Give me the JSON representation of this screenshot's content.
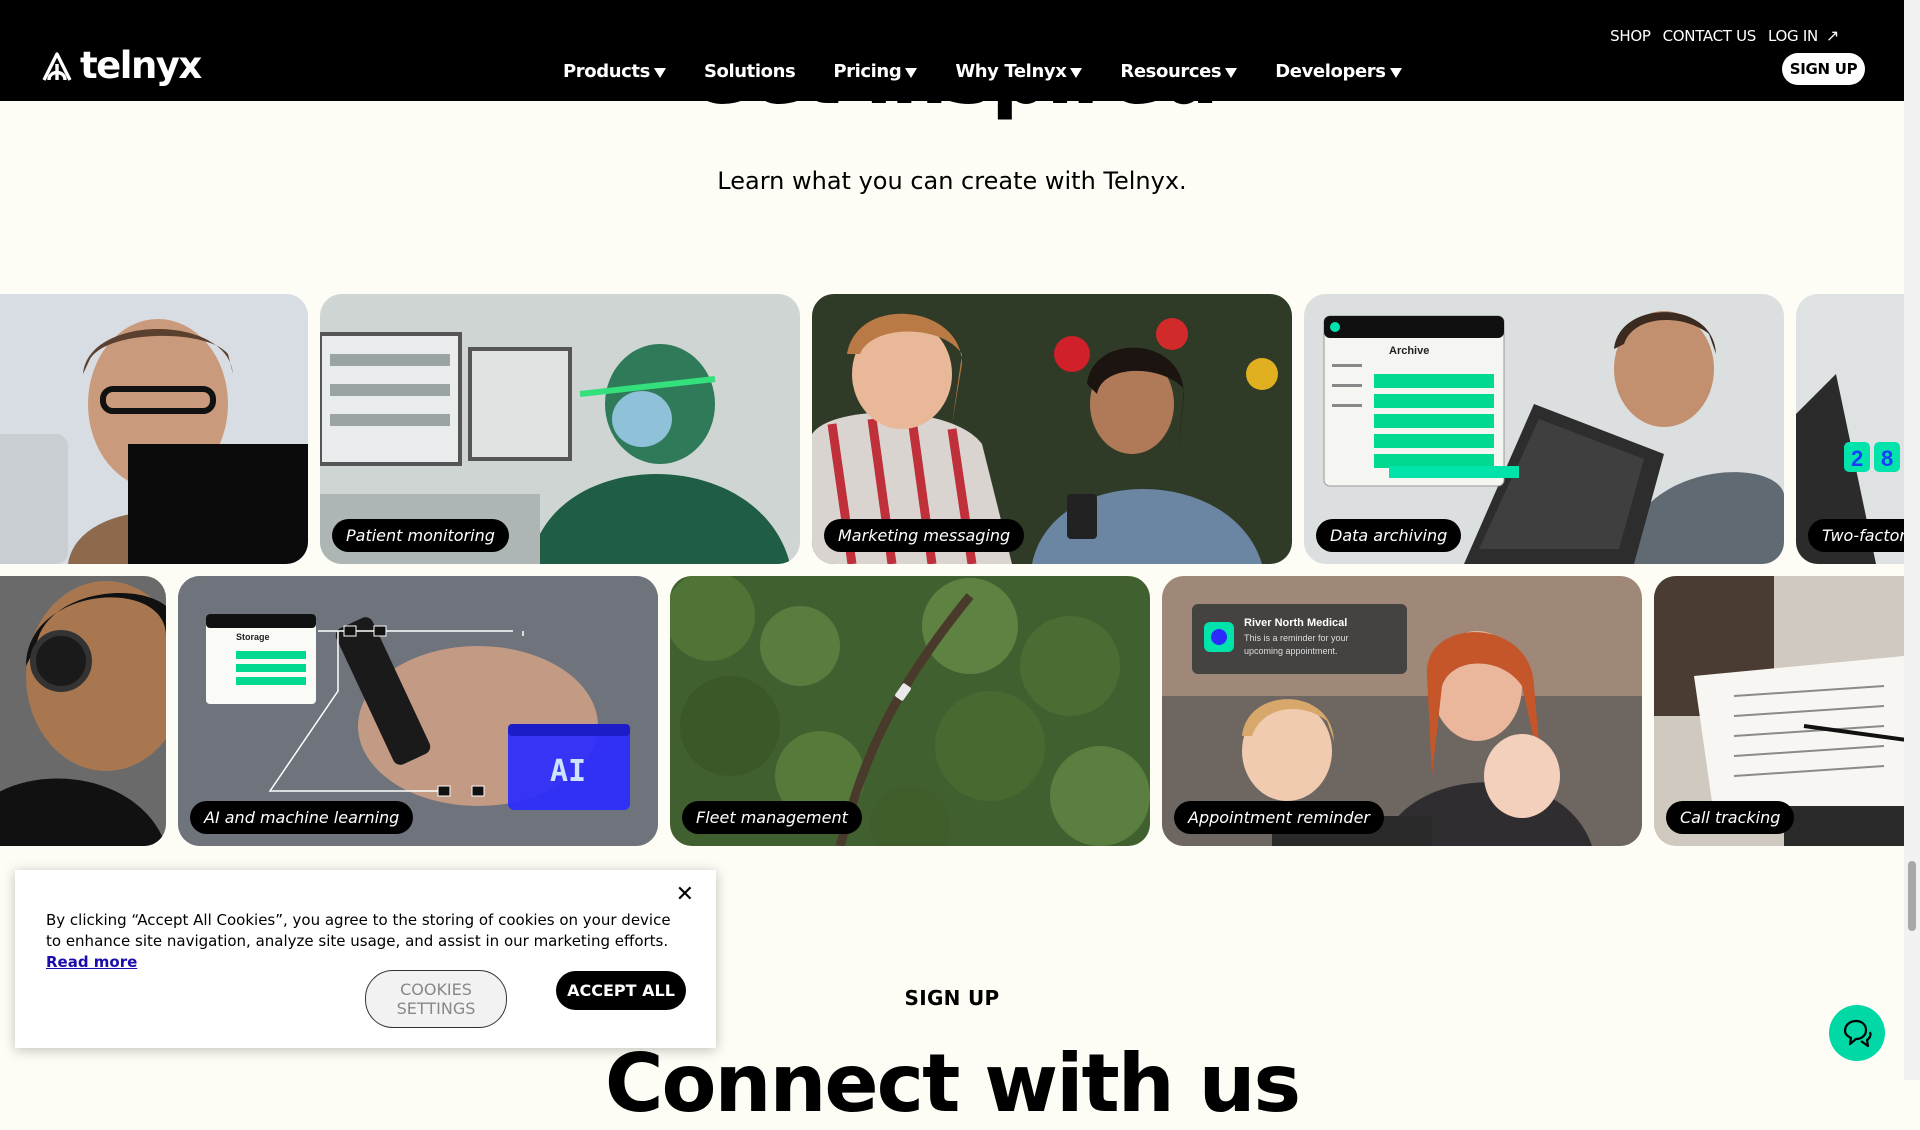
{
  "header": {
    "logo_text": "telnyx",
    "utility_links": [
      "SHOP",
      "CONTACT US",
      "LOG IN"
    ],
    "nav": [
      {
        "label": "Products",
        "dropdown": true
      },
      {
        "label": "Solutions",
        "dropdown": false
      },
      {
        "label": "Pricing",
        "dropdown": true
      },
      {
        "label": "Why Telnyx",
        "dropdown": true
      },
      {
        "label": "Resources",
        "dropdown": true
      },
      {
        "label": "Developers",
        "dropdown": true
      }
    ],
    "signup_label": "SIGN UP"
  },
  "hero": {
    "title": "Get inspired",
    "subtitle": "Learn what you can create with Telnyx."
  },
  "use_cases": {
    "row1": [
      {
        "label": "",
        "bg": "#4a5560",
        "icon": "person-headset-photo"
      },
      {
        "label": "Patient monitoring",
        "bg": "#2e6b5a",
        "icon": "surgeon-monitor-photo"
      },
      {
        "label": "Marketing messaging",
        "bg": "#7a5a40",
        "icon": "friends-phone-photo"
      },
      {
        "label": "Data archiving",
        "bg": "#5c6670",
        "icon": "laptop-archive-photo"
      },
      {
        "label": "Two-factor",
        "bg": "#b9c0c6",
        "icon": "two-factor-photo"
      }
    ],
    "row2": [
      {
        "label": "",
        "bg": "#2a2a2a",
        "icon": "person-headphones-photo"
      },
      {
        "label": "AI and machine learning",
        "bg": "#5b5f6b",
        "icon": "ai-phone-photo"
      },
      {
        "label": "Fleet management",
        "bg": "#3f5e2c",
        "icon": "forest-road-photo"
      },
      {
        "label": "Appointment reminder",
        "bg": "#8a7060",
        "icon": "family-reminder-photo"
      },
      {
        "label": "Call tracking",
        "bg": "#c9c4bc",
        "icon": "notes-desk-photo"
      }
    ],
    "overlays": {
      "archive_title": "Archive",
      "storage_title": "Storage",
      "ai_badge": "AI",
      "twofa_digits": [
        "2",
        "8"
      ],
      "reminder_sender": "River North Medical",
      "reminder_text": "This is a reminder for your upcoming appointment."
    }
  },
  "bottom": {
    "signup_cta": "SIGN UP",
    "connect_title": "Connect with us"
  },
  "cookie_banner": {
    "text": "By clicking “Accept All Cookies”, you agree to the storing of cookies on your device to enhance site navigation, analyze site usage, and assist in our marketing efforts.",
    "read_more": "Read more",
    "settings_line1": "COOKIES",
    "settings_line2": "SETTINGS",
    "accept_label": "ACCEPT ALL",
    "close_glyph": "✕"
  },
  "colors": {
    "accent": "#00e3aa",
    "header_bg": "#000000",
    "page_bg": "#fefdf5"
  }
}
